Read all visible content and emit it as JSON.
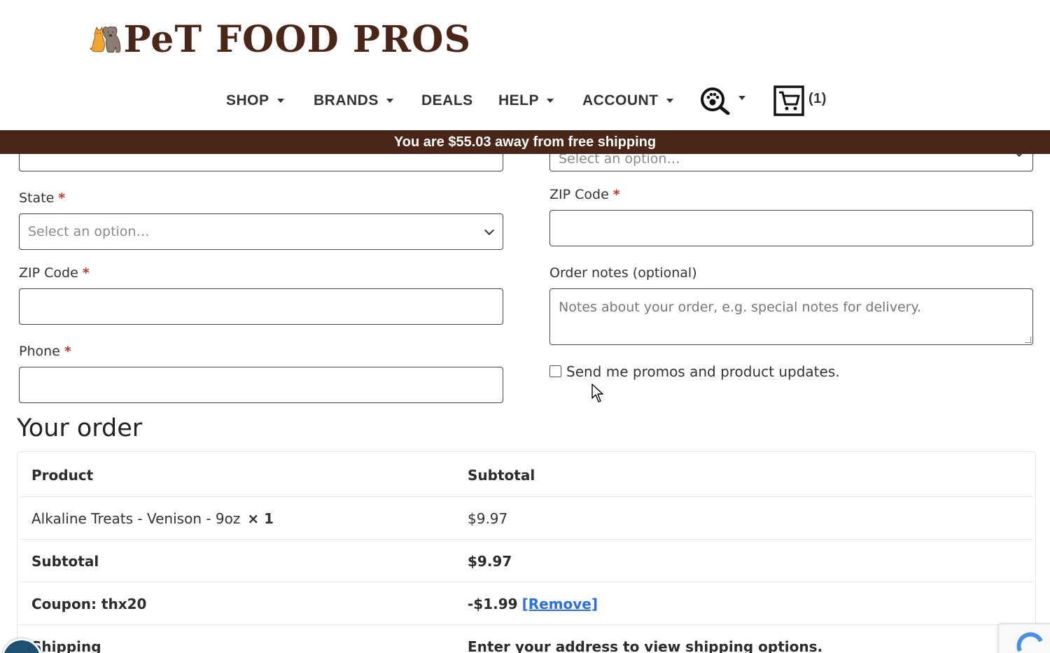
{
  "brand": {
    "name": "PeT FOOD PROS",
    "color": "#4a2619"
  },
  "nav": {
    "shop": "SHOP",
    "brands": "BRANDS",
    "deals": "DEALS",
    "help": "HELP",
    "account": "ACCOUNT",
    "search_icon": "paw-search-icon",
    "cart_icon": "cart-icon",
    "cart_count": "(1)"
  },
  "banner": {
    "text": "You are $55.03 away from free shipping"
  },
  "form": {
    "left": {
      "state_label": "State",
      "state_placeholder": "Select an option…",
      "zip_label": "ZIP Code",
      "phone_label": "Phone"
    },
    "right": {
      "partial_select_placeholder": "Select an option…",
      "zip_label": "ZIP Code",
      "notes_label": "Order notes (optional)",
      "notes_placeholder": "Notes about your order, e.g. special notes for delivery.",
      "promo_label": "Send me promos and product updates."
    },
    "required_mark": "*"
  },
  "order": {
    "title": "Your order",
    "header": {
      "product": "Product",
      "subtotal": "Subtotal"
    },
    "item": {
      "name": "Alkaline Treats - Venison - 9oz",
      "qty": "× 1",
      "price": "$9.97"
    },
    "subtotal": {
      "label": "Subtotal",
      "value": "$9.97"
    },
    "coupon": {
      "label": "Coupon: thx20",
      "value": "-$1.99",
      "remove": "[Remove]"
    },
    "shipping": {
      "label": "Shipping",
      "value": "Enter your address to view shipping options."
    }
  }
}
